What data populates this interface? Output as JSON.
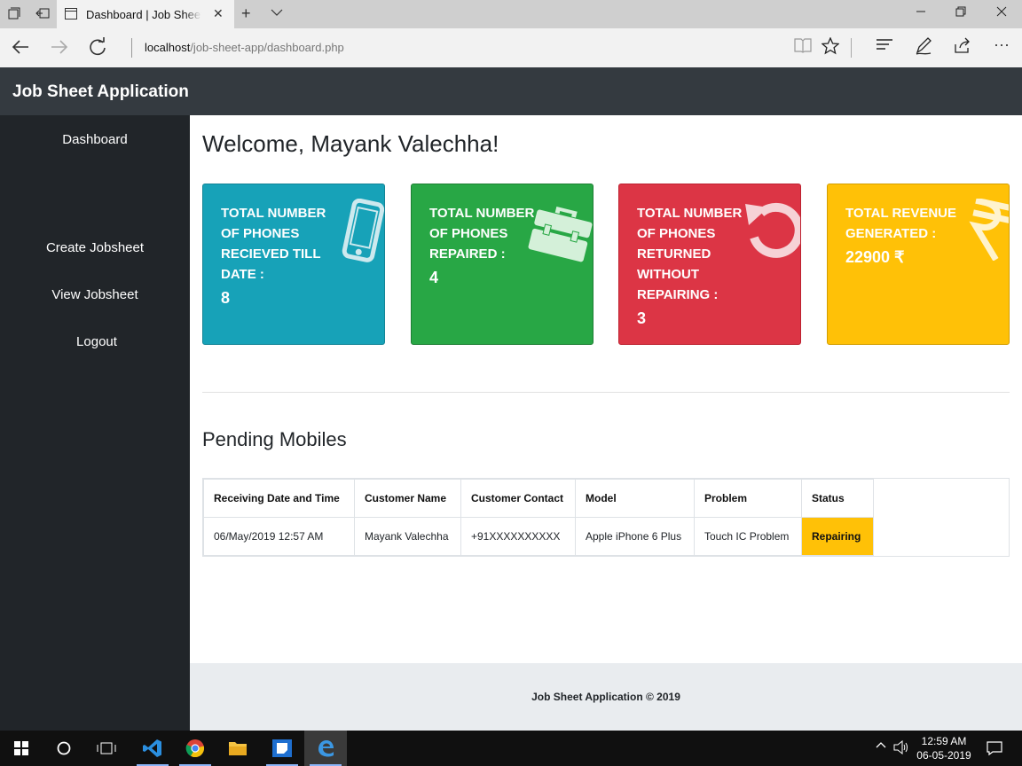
{
  "browser": {
    "tab_title": "Dashboard | Job Sheet Application",
    "url_host": "localhost",
    "url_path": "/job-sheet-app/dashboard.php"
  },
  "app": {
    "brand": "Job Sheet Application"
  },
  "sidebar": {
    "items": [
      {
        "label": "Dashboard"
      },
      {
        "label": "Create Jobsheet"
      },
      {
        "label": "View Jobsheet"
      },
      {
        "label": "Logout"
      }
    ]
  },
  "main": {
    "welcome": "Welcome, Mayank Valechha!",
    "cards": [
      {
        "label": "TOTAL NUMBER OF PHONES RECIEVED TILL DATE :",
        "value": "8",
        "icon": "mobile-phone-icon",
        "color": "#17a2b8"
      },
      {
        "label": "TOTAL NUMBER OF PHONES REPAIRED :",
        "value": "4",
        "icon": "toolbox-icon",
        "color": "#28a745"
      },
      {
        "label": "TOTAL NUMBER OF PHONES RETURNED WITHOUT REPAIRING :",
        "value": "3",
        "icon": "undo-icon",
        "color": "#dc3545"
      },
      {
        "label": "TOTAL REVENUE GENERATED :",
        "value": "22900 ₹",
        "icon": "rupee-icon",
        "color": "#ffc107"
      }
    ],
    "pending_title": "Pending Mobiles",
    "table": {
      "headers": [
        "Receiving Date and Time",
        "Customer Name",
        "Customer Contact",
        "Model",
        "Problem",
        "Status"
      ],
      "rows": [
        [
          "06/May/2019 12:57 AM",
          "Mayank Valechha",
          "+91XXXXXXXXXX",
          "Apple iPhone 6 Plus",
          "Touch IC Problem",
          "Repairing"
        ]
      ]
    }
  },
  "footer": {
    "text": "Job Sheet Application © 2019"
  },
  "taskbar": {
    "time": "12:59 AM",
    "date": "06-05-2019"
  }
}
